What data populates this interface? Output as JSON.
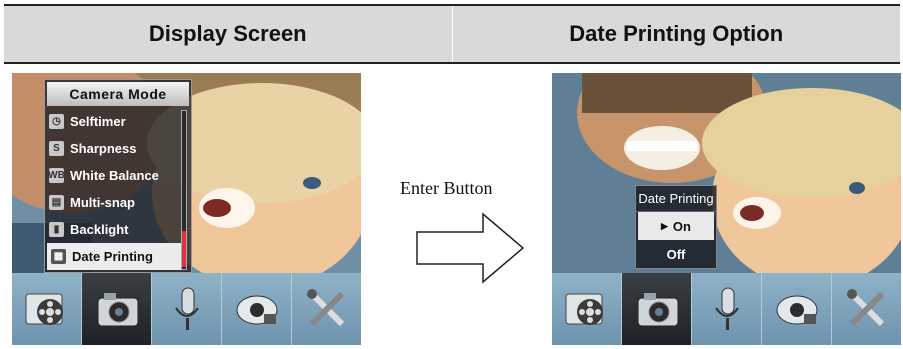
{
  "header": {
    "left_title": "Display Screen",
    "right_title": "Date Printing Option"
  },
  "left_screen": {
    "menu_title": "Camera Mode",
    "items": [
      {
        "label": "Selftimer",
        "icon": "timer-icon",
        "glyph": "◷"
      },
      {
        "label": "Sharpness",
        "icon": "sharpness-icon",
        "glyph": "S"
      },
      {
        "label": "White Balance",
        "icon": "white-balance-icon",
        "glyph": "WB"
      },
      {
        "label": "Multi-snap",
        "icon": "multi-snap-icon",
        "glyph": "▤"
      },
      {
        "label": "Backlight",
        "icon": "backlight-icon",
        "glyph": "▮"
      },
      {
        "label": "Date Printing",
        "icon": "date-printing-icon",
        "glyph": "▦"
      }
    ],
    "selected_item": "Date Printing"
  },
  "middle": {
    "label": "Enter Button"
  },
  "right_screen": {
    "menu_title": "Date Printing",
    "options": [
      {
        "label": "On",
        "selected": true
      },
      {
        "label": "Off",
        "selected": false
      }
    ]
  },
  "toolbar": {
    "icons": [
      "film-reel-icon",
      "camera-icon",
      "microphone-icon",
      "playback-icon",
      "tools-icon"
    ],
    "active": "camera-icon"
  },
  "colors": {
    "header_bg": "#d9d9d9",
    "toolbar_bg": "#7fa3bb",
    "active_tool_bg": "#2a2e33"
  }
}
